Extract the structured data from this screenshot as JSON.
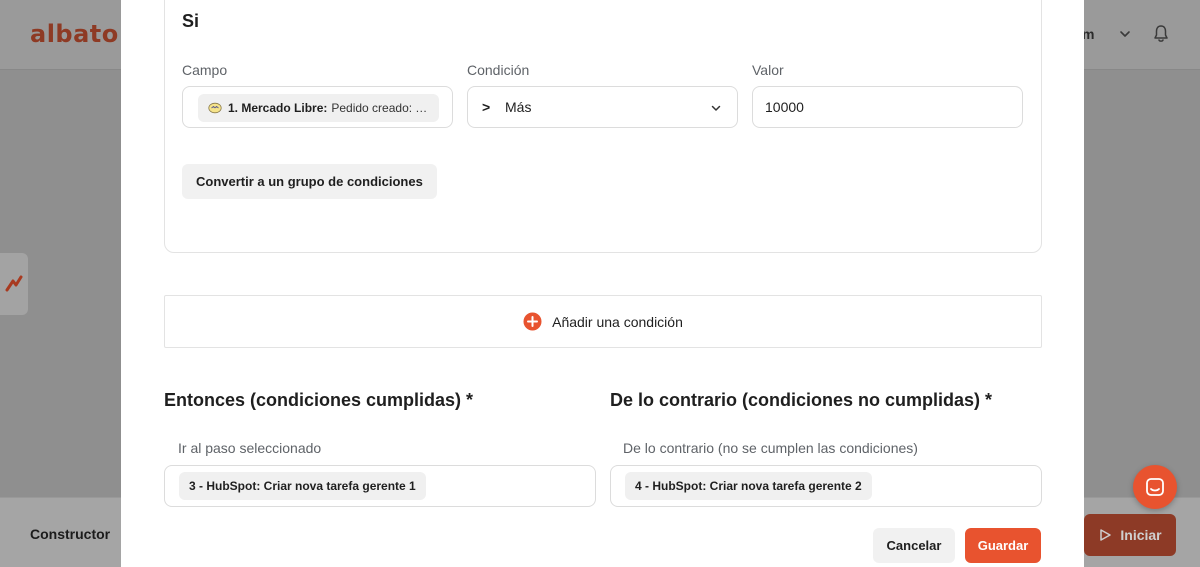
{
  "background": {
    "logo": "albato",
    "user_name": "m",
    "footer_title": "Constructor",
    "start_button": "Iniciar"
  },
  "modal": {
    "si_title": "Si",
    "condition": {
      "campo_label": "Campo",
      "campo_app": "1. Mercado Libre:",
      "campo_value": "Pedido creado: T...",
      "condicion_label": "Condición",
      "condicion_symbol": ">",
      "condicion_value": "Más",
      "valor_label": "Valor",
      "valor_value": "10000",
      "convert_button": "Convertir a un grupo de condiciones"
    },
    "add_condition": "Añadir una condición",
    "then": {
      "title": "Entonces (condiciones cumplidas) *",
      "label": "Ir al paso seleccionado",
      "step": "3 - HubSpot: Criar nova tarefa gerente 1"
    },
    "else": {
      "title": "De lo contrario (condiciones no cumplidas) *",
      "label": "De lo contrario (no se cumplen las condiciones)",
      "step": "4 - HubSpot: Criar nova tarefa gerente 2"
    },
    "cancel_button": "Cancelar",
    "save_button": "Guardar"
  },
  "colors": {
    "accent": "#e8532f",
    "overlay_bg": "#8f8f8f"
  },
  "icons": [
    "chevron-down-icon",
    "bell-icon",
    "plus-circle-icon",
    "play-icon",
    "chat-icon",
    "mercado-libre-icon"
  ]
}
